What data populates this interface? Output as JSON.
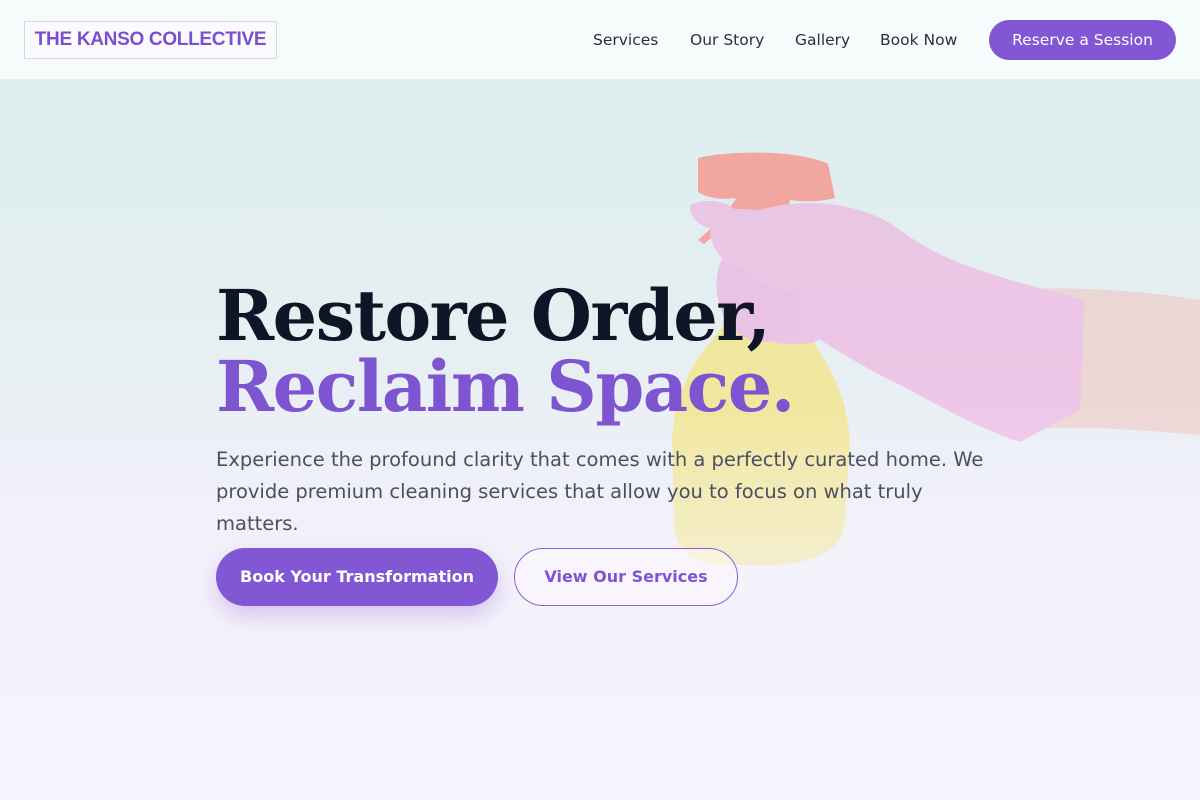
{
  "brand": {
    "name": "THE KANSO COLLECTIVE",
    "accent_color": "#8157d3"
  },
  "nav": {
    "items": [
      {
        "label": "Services"
      },
      {
        "label": "Our Story"
      },
      {
        "label": "Gallery"
      },
      {
        "label": "Book Now"
      }
    ],
    "cta_label": "Reserve a Session"
  },
  "hero": {
    "headline_line1": "Restore Order,",
    "headline_line2": "Reclaim Space.",
    "headline_line1_color": "#0f1526",
    "headline_line2_color": "#7e55d0",
    "subtext": "Experience the profound clarity that comes with a perfectly curated home. We provide premium cleaning services that allow you to focus on what truly matters.",
    "primary_button_label": "Book Your Transformation",
    "secondary_button_label": "View Our Services",
    "background_image": "gloved-hand-holding-spray-bottle"
  }
}
